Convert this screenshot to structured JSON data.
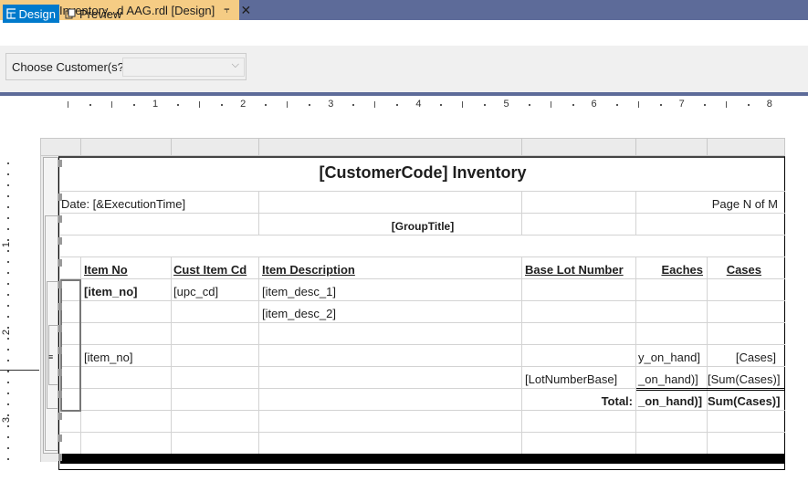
{
  "tab": {
    "title": "Customer Inventory...d AAG.rdl [Design]",
    "pin_icon": "pin-icon",
    "close_icon": "close-icon",
    "accent": "#f5cc84"
  },
  "modes": {
    "design": "Design",
    "preview": "Preview",
    "design_color": "#007acc"
  },
  "parameters": {
    "customer_label": "Choose Customer(s?)",
    "customer_value": ""
  },
  "ruler": {
    "numbers": [
      "1",
      "2",
      "3",
      "4",
      "5",
      "6",
      "7",
      "8"
    ]
  },
  "vruler": {
    "numbers": [
      "1",
      "2",
      "3"
    ]
  },
  "report": {
    "title": "[CustomerCode] Inventory",
    "date": "Date: [&ExecutionTime]",
    "page": "Page N of M",
    "group_title": "[GroupTitle]",
    "headers": {
      "item_no": "Item No",
      "cust_item_cd": "Cust Item Cd",
      "item_description": "Item Description",
      "base_lot_number": "Base Lot Number",
      "eaches": "Eaches",
      "cases": "Cases"
    },
    "detail": {
      "item_no": "[item_no]",
      "upc_cd": "[upc_cd]",
      "item_desc_1": "[item_desc_1]",
      "item_desc_2": "[item_desc_2]"
    },
    "group_row": {
      "item_no": "[item_no]",
      "qty": "y_on_hand]",
      "cases": "[Cases]"
    },
    "lot_row": {
      "lot": "[LotNumberBase]",
      "qty": "_on_hand)]",
      "cases": "[Sum(Cases)]"
    },
    "total_row": {
      "label": "Total:",
      "qty": "_on_hand)]",
      "cases": "Sum(Cases)]"
    }
  }
}
